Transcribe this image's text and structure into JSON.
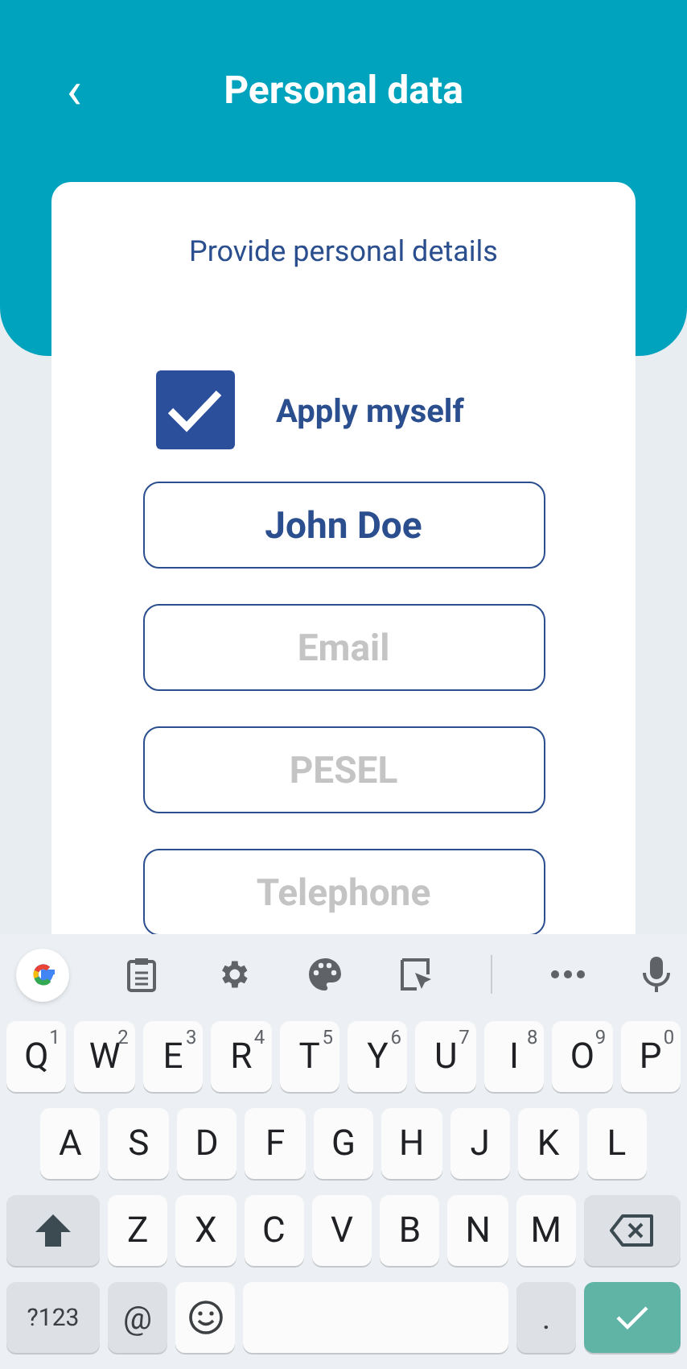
{
  "header": {
    "back": "‹",
    "title": "Personal data"
  },
  "card": {
    "heading": "Provide personal details",
    "apply_myself": {
      "label": "Apply myself",
      "checked": true
    },
    "fields": [
      {
        "value": "John Doe"
      },
      {
        "placeholder": "Email"
      },
      {
        "placeholder": "PESEL"
      },
      {
        "placeholder": "Telephone"
      }
    ]
  },
  "keyboard": {
    "rows": [
      {
        "keys": [
          {
            "kind": "letter",
            "label": "Q",
            "hint": "1"
          },
          {
            "kind": "letter",
            "label": "W",
            "hint": "2"
          },
          {
            "kind": "letter",
            "label": "E",
            "hint": "3"
          },
          {
            "kind": "letter",
            "label": "R",
            "hint": "4"
          },
          {
            "kind": "letter",
            "label": "T",
            "hint": "5"
          },
          {
            "kind": "letter",
            "label": "Y",
            "hint": "6"
          },
          {
            "kind": "letter",
            "label": "U",
            "hint": "7"
          },
          {
            "kind": "letter",
            "label": "I",
            "hint": "8"
          },
          {
            "kind": "letter",
            "label": "O",
            "hint": "9"
          },
          {
            "kind": "letter",
            "label": "P",
            "hint": "0"
          }
        ]
      },
      {
        "keys": [
          {
            "kind": "letter",
            "label": "A"
          },
          {
            "kind": "letter",
            "label": "S"
          },
          {
            "kind": "letter",
            "label": "D"
          },
          {
            "kind": "letter",
            "label": "F"
          },
          {
            "kind": "letter",
            "label": "G"
          },
          {
            "kind": "letter",
            "label": "H"
          },
          {
            "kind": "letter",
            "label": "J"
          },
          {
            "kind": "letter",
            "label": "K"
          },
          {
            "kind": "letter",
            "label": "L"
          }
        ]
      },
      {
        "keys": [
          {
            "kind": "shift"
          },
          {
            "kind": "letter",
            "label": "Z"
          },
          {
            "kind": "letter",
            "label": "X"
          },
          {
            "kind": "letter",
            "label": "C"
          },
          {
            "kind": "letter",
            "label": "V"
          },
          {
            "kind": "letter",
            "label": "B"
          },
          {
            "kind": "letter",
            "label": "N"
          },
          {
            "kind": "letter",
            "label": "M"
          },
          {
            "kind": "backspace"
          }
        ]
      },
      {
        "keys": [
          {
            "kind": "symbols",
            "label": "?123"
          },
          {
            "kind": "function",
            "label": "@"
          },
          {
            "kind": "emoji"
          },
          {
            "kind": "space"
          },
          {
            "kind": "function",
            "label": "."
          },
          {
            "kind": "enter"
          }
        ]
      }
    ]
  }
}
